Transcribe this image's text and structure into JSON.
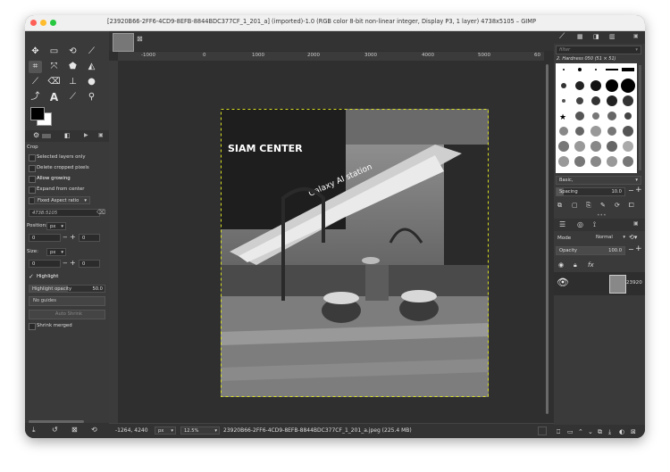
{
  "window": {
    "title": "[23920B66-2FF6-4CD9-8EFB-8844BDC377CF_1_201_a] (imported)-1.0 (RGB color 8-bit non-linear integer, Display P3, 1 layer) 4738x5105 – GIMP"
  },
  "colors": {
    "close": "#fe5f57",
    "minimize": "#febc2e",
    "zoom": "#28c840",
    "canvas_bg": "#2f2f2f",
    "panel_bg": "#3a3a3a",
    "selection": "#d9e021"
  },
  "tool_options": {
    "title": "Crop",
    "selected_layers_only": "Selected layers only",
    "delete_cropped_pixels": "Delete cropped pixels",
    "allow_growing": "Allow growing",
    "expand_from_center": "Expand from center",
    "aspect_mode": "Fixed Aspect ratio",
    "aspect_value": "4738:5105",
    "position_label": "Position:",
    "position_unit": "px",
    "position_x": "0",
    "position_y": "0",
    "size_label": "Size:",
    "size_unit": "px",
    "size_w": "0",
    "size_h": "0",
    "highlight": "Highlight",
    "highlight_opacity_label": "Highlight opacity",
    "highlight_opacity_value": "50.0",
    "guides": "No guides",
    "auto_shrink": "Auto Shrink",
    "shrink_merged": "Shrink merged"
  },
  "ruler": {
    "labels": [
      "-1000",
      "0",
      "1000",
      "2000",
      "3000",
      "4000",
      "5000",
      "60"
    ]
  },
  "image_text": {
    "logo": "SIAM CENTER",
    "banner": "Galaxy AI station"
  },
  "brushes": {
    "filter_placeholder": "filter",
    "current": "2. Hardness 050 (51 × 51)",
    "tag": "Basic,",
    "spacing_label": "Spacing",
    "spacing_value": "10.0"
  },
  "layers": {
    "mode_label": "Mode",
    "mode_value": "Normal",
    "opacity_label": "Opacity",
    "opacity_value": "100.0",
    "layer_name": "23920"
  },
  "status": {
    "coords": "-1264, 4240",
    "unit": "px",
    "zoom": "12.5%",
    "filename": "23920B66-2FF6-4CD9-8EFB-8844BDC377CF_1_201_a.jpeg (225.4 MB)"
  }
}
